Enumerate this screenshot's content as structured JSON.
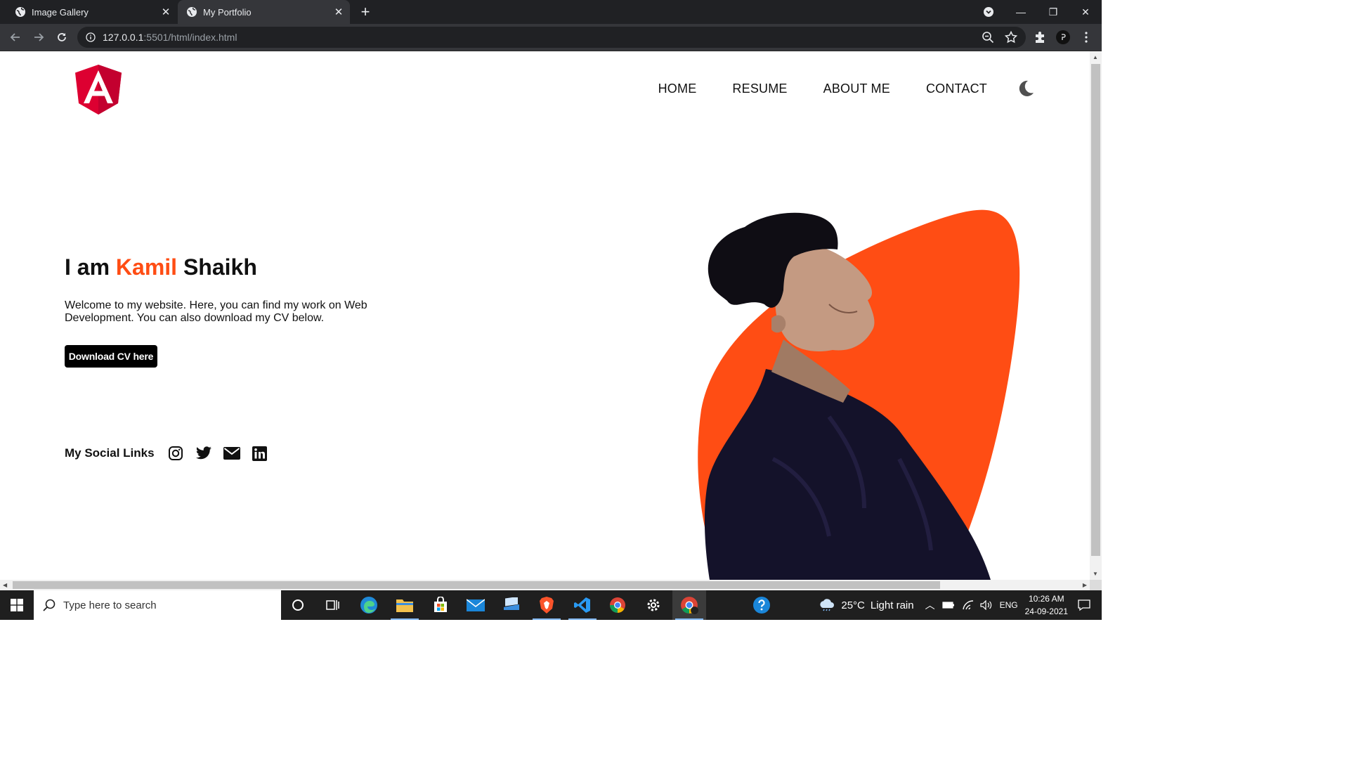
{
  "browser": {
    "tabs": [
      {
        "title": "Image Gallery",
        "active": false
      },
      {
        "title": "My Portfolio",
        "active": true
      }
    ],
    "url_host": "127.0.0.1",
    "url_rest": ":5501/html/index.html"
  },
  "site": {
    "nav": [
      "HOME",
      "RESUME",
      "ABOUT ME",
      "CONTACT"
    ],
    "theme_toggle_icon": "moon-icon",
    "hero": {
      "title_prefix": "I am ",
      "title_first": "Kamil",
      "title_last": " Shaikh",
      "description": "Welcome to my website. Here, you can find my work on Web Development. You can also download my CV below.",
      "button_label": "Download CV here"
    },
    "social": {
      "title": "My Social Links",
      "icons": [
        "instagram-icon",
        "twitter-icon",
        "email-icon",
        "linkedin-icon"
      ]
    },
    "colors": {
      "accent": "#ff4d14",
      "button_bg": "#000000",
      "logo_red": "#dd0031"
    }
  },
  "taskbar": {
    "search_placeholder": "Type here to search",
    "weather_temp": "25°C",
    "weather_desc": "Light rain",
    "language": "ENG",
    "time": "10:26 AM",
    "date": "24-09-2021"
  }
}
